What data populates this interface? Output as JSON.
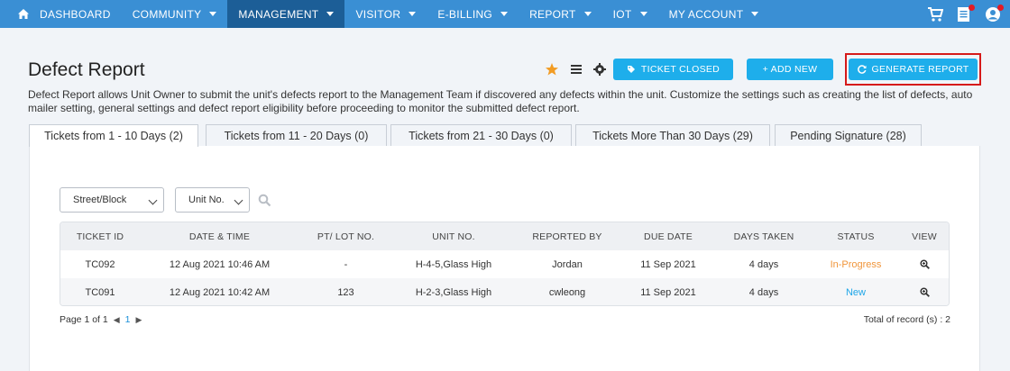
{
  "nav": {
    "items": [
      {
        "label": "DASHBOARD",
        "active": false,
        "caret": false
      },
      {
        "label": "COMMUNITY",
        "active": false,
        "caret": true
      },
      {
        "label": "MANAGEMENT",
        "active": true,
        "caret": true
      },
      {
        "label": "VISITOR",
        "active": false,
        "caret": true
      },
      {
        "label": "E-BILLING",
        "active": false,
        "caret": true
      },
      {
        "label": "REPORT",
        "active": false,
        "caret": true
      },
      {
        "label": "IOT",
        "active": false,
        "caret": true
      },
      {
        "label": "MY ACCOUNT",
        "active": false,
        "caret": true
      }
    ],
    "icons": [
      "cart-icon",
      "document-icon",
      "user-profile-icon"
    ]
  },
  "page": {
    "title": "Defect Report",
    "description": "Defect Report allows Unit Owner to submit the unit's defects report to the Management Team if discovered any defects within the unit. Customize the settings such as creating the list of defects, auto mailer setting, general settings and defect report eligibility before proceeding to monitor the submitted defect report."
  },
  "toolbar": {
    "ticket_closed": "TICKET CLOSED",
    "add_new": "+ ADD NEW",
    "generate_report": "GENERATE REPORT"
  },
  "tabs": [
    {
      "label": "Tickets from 1 - 10 Days (2)",
      "active": true
    },
    {
      "label": "Tickets from 11 - 20 Days (0)",
      "active": false
    },
    {
      "label": "Tickets from 21 - 30 Days (0)",
      "active": false
    },
    {
      "label": "Tickets More Than 30 Days (29)",
      "active": false
    },
    {
      "label": "Pending Signature (28)",
      "active": false
    }
  ],
  "filters": {
    "street_block": "Street/Block",
    "unit_no": "Unit No."
  },
  "table": {
    "headers": [
      "TICKET ID",
      "DATE & TIME",
      "PT/ LOT NO.",
      "UNIT NO.",
      "REPORTED BY",
      "DUE DATE",
      "DAYS TAKEN",
      "STATUS",
      "VIEW"
    ],
    "rows": [
      {
        "ticket_id": "TC092",
        "date_time": "12 Aug 2021 10:46 AM",
        "lot_no": "-",
        "unit_no": "H-4-5,Glass High",
        "reported_by": "Jordan",
        "due_date": "11 Sep 2021",
        "days_taken": "4 days",
        "status": "In-Progress"
      },
      {
        "ticket_id": "TC091",
        "date_time": "12 Aug 2021 10:42 AM",
        "lot_no": "123",
        "unit_no": "H-2-3,Glass High",
        "reported_by": "cwleong",
        "due_date": "11 Sep 2021",
        "days_taken": "4 days",
        "status": "New"
      }
    ]
  },
  "pagination": {
    "page_text": "Page 1 of 1",
    "current": "1",
    "total": "Total of record (s) : 2"
  },
  "colors": {
    "nav": "#3a8fd4",
    "nav_active": "#1c5e97",
    "button": "#1eaeeb",
    "status_in_progress": "#f0953a",
    "status_new": "#1ea6e8",
    "highlight": "#d61a1a",
    "star": "#f29c24"
  }
}
